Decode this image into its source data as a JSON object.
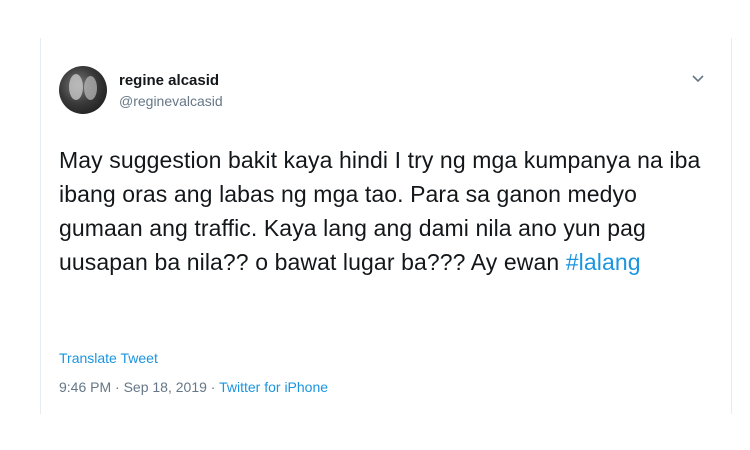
{
  "tweet": {
    "display_name": "regine alcasid",
    "username": "@reginevalcasid",
    "text_main": "May suggestion bakit kaya hindi I try ng mga kumpanya na iba ibang oras ang labas ng mga tao. Para sa ganon medyo gumaan ang traffic. Kaya lang ang dami nila ano yun pag uusapan ba nila?? o bawat lugar ba??? Ay ewan ",
    "hashtag": "#lalang",
    "translate_label": "Translate Tweet",
    "time": "9:46 PM",
    "separator": " · ",
    "date": "Sep 18, 2019",
    "source": "Twitter for iPhone"
  },
  "icons": {
    "caret": "chevron-down-icon",
    "avatar": "avatar"
  },
  "colors": {
    "link": "#1b95e0",
    "secondary_text": "#657786",
    "primary_text": "#14171a",
    "border": "#e6ecf0"
  }
}
